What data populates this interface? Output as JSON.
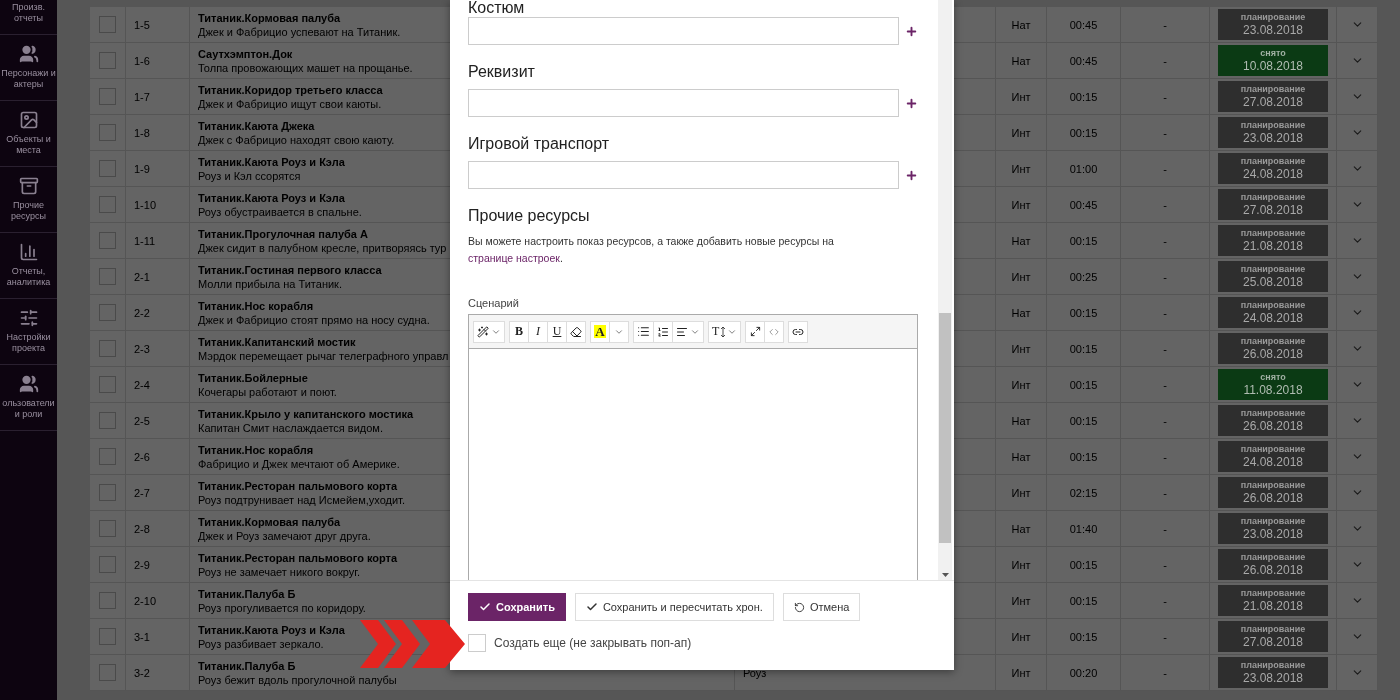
{
  "sidebar": {
    "items": [
      {
        "kind": "reports",
        "label": "Произв. отчеты"
      },
      {
        "kind": "people",
        "label": "Персонажи и актеры"
      },
      {
        "kind": "places",
        "label": "Объекты и места"
      },
      {
        "kind": "resources",
        "label": "Прочие ресурсы"
      },
      {
        "kind": "analytics",
        "label": "Отчеты, аналитика"
      },
      {
        "kind": "settings",
        "label": "Настройки проекта"
      },
      {
        "kind": "people",
        "label": "ользователи и роли"
      }
    ]
  },
  "table": {
    "rows": [
      {
        "checked": false,
        "number": "1-5",
        "title": "Титаник.Кормовая палуба",
        "description": "Джек и Фабрицио успевают на Титаник.",
        "location": "Нат",
        "duration": "00:45",
        "column_6": "-",
        "status": {
          "kind": "planning",
          "label": "планирование",
          "date": "23.08.2018"
        }
      },
      {
        "checked": false,
        "number": "1-6",
        "title": "Саутхэмптон.Док",
        "description": "Толпа провожающих машет на прощанье.",
        "location": "Нат",
        "duration": "00:45",
        "column_6": "-",
        "status": {
          "kind": "shot",
          "label": "снято",
          "date": "10.08.2018"
        }
      },
      {
        "checked": false,
        "number": "1-7",
        "title": "Титаник.Коридор третьего класса",
        "description": "Джек и Фабрицио ищут свои каюты.",
        "location": "Инт",
        "duration": "00:15",
        "column_6": "-",
        "status": {
          "kind": "planning",
          "label": "планирование",
          "date": "27.08.2018"
        }
      },
      {
        "checked": false,
        "number": "1-8",
        "title": "Титаник.Каюта Джека",
        "description": "Джек с Фабрицио находят свою каюту.",
        "location": "Инт",
        "duration": "00:15",
        "column_6": "-",
        "status": {
          "kind": "planning",
          "label": "планирование",
          "date": "23.08.2018"
        }
      },
      {
        "checked": false,
        "number": "1-9",
        "title": "Титаник.Каюта Роуз и Кэла",
        "description": "Роуз и Кэл ссорятся",
        "location": "Инт",
        "duration": "01:00",
        "column_6": "-",
        "status": {
          "kind": "planning",
          "label": "планирование",
          "date": "24.08.2018"
        }
      },
      {
        "checked": false,
        "number": "1-10",
        "title": "Титаник.Каюта Роуз и Кэла",
        "description": "Роуз обустраивается в спальне.",
        "location": "Инт",
        "duration": "00:45",
        "column_6": "-",
        "status": {
          "kind": "planning",
          "label": "планирование",
          "date": "27.08.2018"
        }
      },
      {
        "checked": false,
        "number": "1-11",
        "title": "Титаник.Прогулочная палуба А",
        "description": "Джек сидит в палубном кресле, притворяясь тур",
        "location": "Нат",
        "duration": "00:15",
        "column_6": "-",
        "status": {
          "kind": "planning",
          "label": "планирование",
          "date": "21.08.2018"
        }
      },
      {
        "checked": false,
        "number": "2-1",
        "title": "Титаник.Гостиная первого класса",
        "description": "Молли прибыла на Титаник.",
        "location": "Инт",
        "duration": "00:25",
        "column_6": "-",
        "status": {
          "kind": "planning",
          "label": "планирование",
          "date": "25.08.2018"
        }
      },
      {
        "checked": false,
        "number": "2-2",
        "title": "Титаник.Нос корабля",
        "description": "Джек и Фабрицио стоят прямо на носу судна.",
        "location": "Нат",
        "duration": "00:15",
        "column_6": "-",
        "status": {
          "kind": "planning",
          "label": "планирование",
          "date": "24.08.2018"
        }
      },
      {
        "checked": false,
        "number": "2-3",
        "title": "Титаник.Капитанский мостик",
        "description": "Мэрдок перемещает рычаг телеграфного управл",
        "location": "Инт",
        "duration": "00:15",
        "column_6": "-",
        "status": {
          "kind": "planning",
          "label": "планирование",
          "date": "26.08.2018"
        }
      },
      {
        "checked": false,
        "number": "2-4",
        "title": "Титаник.Бойлерные",
        "description": "Кочегары работают и поют.",
        "location": "Инт",
        "duration": "00:15",
        "column_6": "-",
        "status": {
          "kind": "shot",
          "label": "снято",
          "date": "11.08.2018"
        }
      },
      {
        "checked": false,
        "number": "2-5",
        "title": "Титаник.Крыло у капитанского мостика",
        "description": "Капитан Смит наслаждается видом.",
        "location": "Нат",
        "duration": "00:15",
        "column_6": "-",
        "status": {
          "kind": "planning",
          "label": "планирование",
          "date": "26.08.2018"
        }
      },
      {
        "checked": false,
        "number": "2-6",
        "title": "Титаник.Нос корабля",
        "description": "Фабрицио и Джек мечтают об Америке.",
        "location": "Нат",
        "duration": "00:15",
        "column_6": "-",
        "status": {
          "kind": "planning",
          "label": "планирование",
          "date": "24.08.2018"
        }
      },
      {
        "checked": false,
        "number": "2-7",
        "title": "Титаник.Ресторан пальмового корта",
        "description": "Роуз подтрунивает над Исмейем,уходит.",
        "location": "Инт",
        "duration": "02:15",
        "column_6": "-",
        "status": {
          "kind": "planning",
          "label": "планирование",
          "date": "26.08.2018"
        }
      },
      {
        "checked": false,
        "number": "2-8",
        "title": "Титаник.Кормовая палуба",
        "description": "Джек и Роуз замечают друг друга.",
        "location": "Нат",
        "duration": "01:40",
        "column_6": "-",
        "status": {
          "kind": "planning",
          "label": "планирование",
          "date": "23.08.2018"
        }
      },
      {
        "checked": false,
        "number": "2-9",
        "title": "Титаник.Ресторан пальмового корта",
        "description": "Роуз не замечает никого вокруг.",
        "location": "Инт",
        "duration": "00:15",
        "column_6": "-",
        "status": {
          "kind": "planning",
          "label": "планирование",
          "date": "26.08.2018"
        }
      },
      {
        "checked": false,
        "number": "2-10",
        "title": "Титаник.Палуба Б",
        "description": "Роуз прогуливается по коридору.",
        "location": "Инт",
        "duration": "00:15",
        "column_6": "-",
        "status": {
          "kind": "planning",
          "label": "планирование",
          "date": "21.08.2018"
        }
      },
      {
        "checked": false,
        "number": "3-1",
        "title": "Титаник.Каюта Роуз и Кэла",
        "description": "Роуз разбивает зеркало.",
        "location": "Инт",
        "duration": "00:15",
        "column_6": "-",
        "status": {
          "kind": "planning",
          "label": "планирование",
          "date": "27.08.2018"
        }
      },
      {
        "checked": false,
        "number": "3-2",
        "title": "Титаник.Палуба Б",
        "description": "Роуз бежит вдоль прогулочной палубы",
        "column_4": "Роуз",
        "location": "Инт",
        "duration": "00:20",
        "column_6": "-",
        "status": {
          "kind": "planning",
          "label": "планирование",
          "date": "23.08.2018"
        }
      }
    ]
  },
  "modal": {
    "sections": [
      {
        "kind": "input",
        "heading": "Костюм"
      },
      {
        "kind": "input",
        "heading": "Реквизит"
      },
      {
        "kind": "input",
        "heading": "Игровой транспорт"
      },
      {
        "kind": "note",
        "heading": "Прочие ресурсы",
        "note": "Вы можете настроить показ ресурсов, а также добавить новые ресурсы на ",
        "link": "странице настроек",
        "note_end": "."
      }
    ],
    "editor": {
      "label": "Сценарий",
      "toolbar": {
        "bold": "B",
        "italic": "I",
        "underline": "U",
        "highlight": "A",
        "font_size": "T"
      }
    },
    "buttons": [
      {
        "kind": "primary",
        "label": "Сохранить"
      },
      {
        "kind": "check",
        "label": "Сохранить и пересчитать хрон."
      },
      {
        "kind": "undo",
        "label": "Отмена"
      }
    ],
    "create_more": {
      "label": "Создать еще (не закрывать поп-ап)",
      "checked": false
    }
  }
}
